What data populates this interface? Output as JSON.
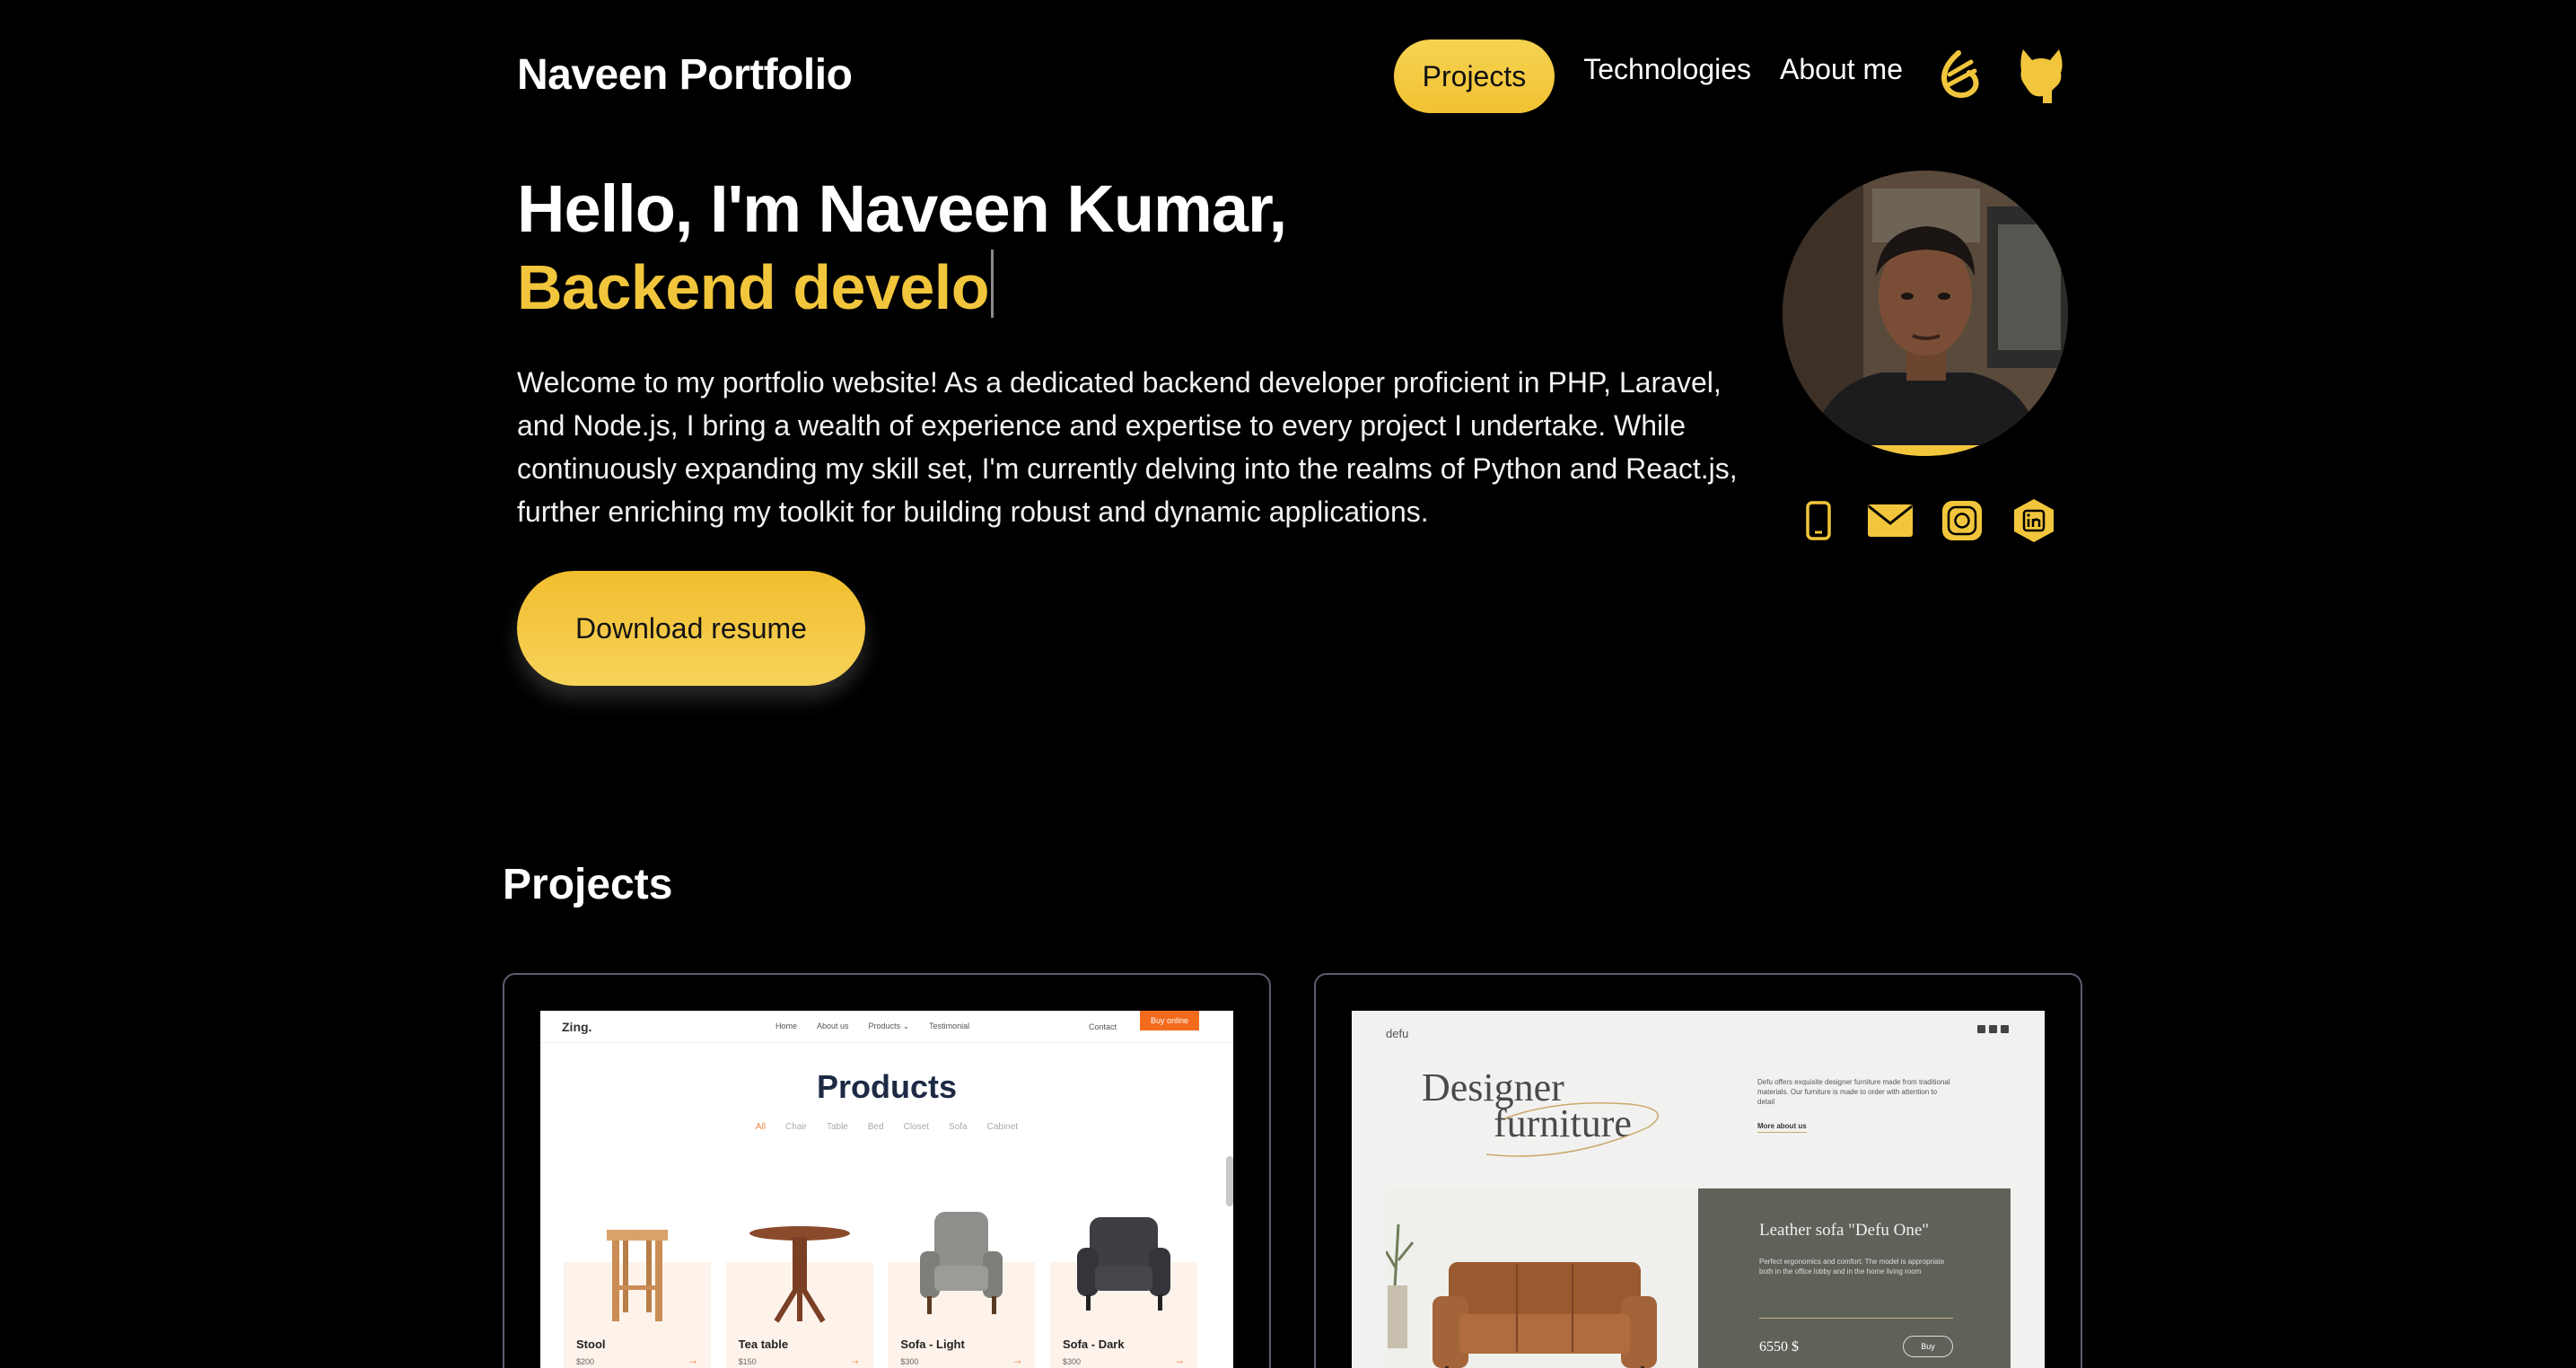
{
  "header": {
    "brand": "Naveen Portfolio",
    "nav": [
      {
        "label": "Projects",
        "active": true
      },
      {
        "label": "Technologies"
      },
      {
        "label": "About me"
      }
    ],
    "icons": [
      "codeigniter-icon",
      "github-icon"
    ]
  },
  "hero": {
    "greeting": "Hello, I'm Naveen Kumar,",
    "role_typing": "Backend develo",
    "intro": "Welcome to my portfolio website! As a dedicated backend developer proficient in PHP, Laravel, and Node.js, I bring a wealth of experience and expertise to every project I undertake. While continuously expanding my skill set, I'm currently delving into the realms of Python and React.js, further enriching my toolkit for building robust and dynamic applications.",
    "resume_button": "Download resume",
    "contact_icons": [
      "phone-icon",
      "mail-icon",
      "instagram-icon",
      "linkedin-icon"
    ]
  },
  "projects": {
    "title": "Projects",
    "zing": {
      "logo": "Zing.",
      "nav": [
        "Home",
        "About us",
        "Products ⌄",
        "Testimonial"
      ],
      "contact": "Contact",
      "buy": "Buy online",
      "heading": "Products",
      "filters": [
        "All",
        "Chair",
        "Table",
        "Bed",
        "Closet",
        "Sofa",
        "Cabinet"
      ],
      "items": [
        {
          "name": "Stool",
          "price": "$200"
        },
        {
          "name": "Tea table",
          "price": "$150"
        },
        {
          "name": "Sofa - Light",
          "price": "$300"
        },
        {
          "name": "Sofa - Dark",
          "price": "$300"
        }
      ]
    },
    "defu": {
      "logo": "defu",
      "title_line1": "Designer",
      "title_line2": "furniture",
      "desc": "Defu offers exquisite designer furniture made from traditional materials. Our furniture is made to order with attention to detail",
      "more": "More about us",
      "product": "Leather sofa \"Defu One\"",
      "product_desc": "Perfect ergonomics and comfort. The model is appropriate both in the office lobby and in the home living room",
      "price": "6550 $",
      "buy": "Buy"
    }
  },
  "colors": {
    "accent": "#f2c63c",
    "background": "#000000",
    "card_border": "#5c5c70"
  }
}
